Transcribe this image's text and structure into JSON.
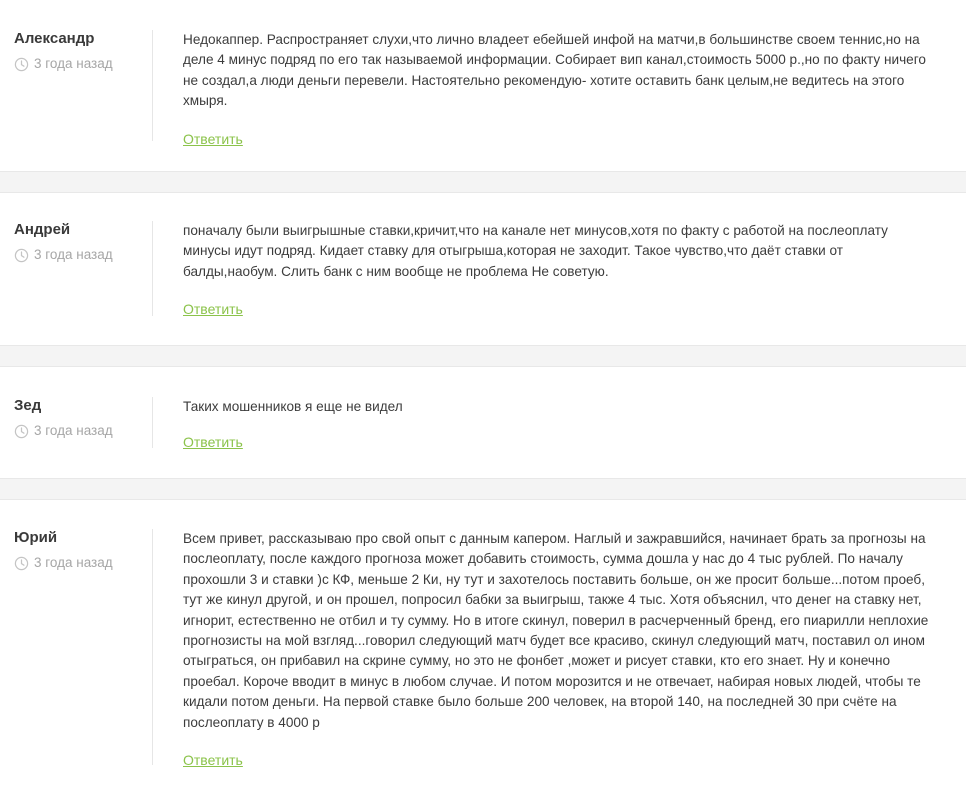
{
  "comments": [
    {
      "author": "Александр",
      "time": "3 года назад",
      "text": "Недокаппер. Распространяет слухи,что лично владеет ебейшей инфой на матчи,в большинстве своем теннис,но на деле 4 минус подряд по его так называемой информации. Собирает вип канал,стоимость 5000 р.,но по факту ничего не создал,а люди деньги перевели. Настоятельно рекомендую- хотите оставить банк целым,не ведитесь на этого хмыря.",
      "reply": "Ответить"
    },
    {
      "author": "Андрей",
      "time": "3 года назад",
      "text": "поначалу были выигрышные ставки,кричит,что на канале нет минусов,хотя по факту с работой на послеоплату минусы идут подряд. Кидает ставку для отыгрыша,которая не заходит. Такое чувство,что даёт ставки от балды,наобум. Слить банк с ним вообще не проблема Не советую.",
      "reply": "Ответить"
    },
    {
      "author": "Зед",
      "time": "3 года назад",
      "text": "Таких мошенников я еще не видел",
      "reply": "Ответить"
    },
    {
      "author": "Юрий",
      "time": "3 года назад",
      "text": "Всем привет, рассказываю про свой опыт с данным капером. Наглый и зажравшийся, начинает брать за прогнозы на послеоплату, после каждого прогноза может добавить стоимость, сумма дошла у нас до 4 тыс рублей. По началу прохошли 3 и ставки )с КФ, меньше 2 Ки, ну тут и захотелось поставить больше, он же просит больше...потом проеб, тут же кинул другой, и он прошел, попросил бабки за выигрыш, также 4 тыс. Хотя объяснил, что денег на ставку нет, игнорит, естественно не отбил и ту сумму. Но в итоге скинул, поверил в расчерченный бренд, его пиарилли неплохие прогнозисты на мой взгляд...говорил следующий матч будет все красиво, скинул следующий матч, поставил ол ином отыграться, он прибавил на скрине сумму, но это не фонбет ,может и рисует ставки, кто его знает. Ну и конечно проебал. Короче вводит в минус в любом случае. И потом морозится и не отвечает, набирая новых людей, чтобы те кидали потом деньги. На первой ставке было больше 200 человек, на второй 140, на последней 30 при счёте на послеоплату в 4000 р",
      "reply": "Ответить"
    }
  ],
  "icons": {
    "time": "clock-icon"
  },
  "colors": {
    "reply_link": "#8bc34a",
    "meta_text": "#a6a6a6",
    "separator": "#f4f4f4"
  }
}
